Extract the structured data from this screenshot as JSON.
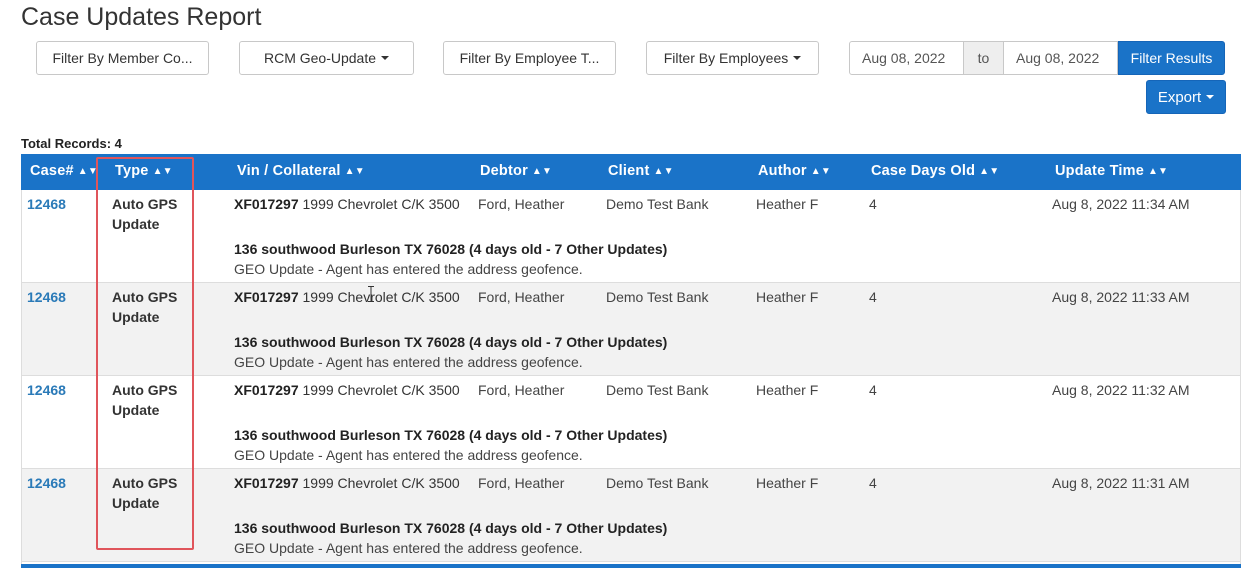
{
  "page": {
    "title": "Case Updates Report"
  },
  "filters": {
    "member_company": "Filter By Member Co...",
    "geo_update": "RCM Geo-Update",
    "employee_type": "Filter By Employee T...",
    "employees": "Filter By Employees",
    "date_from": "Aug 08, 2022",
    "date_to_label": "to",
    "date_to": "Aug 08, 2022",
    "filter_results": "Filter Results",
    "export": "Export"
  },
  "summary": {
    "total_records": "Total Records: 4"
  },
  "table": {
    "headers": [
      "Case#",
      "Type",
      "Vin / Collateral",
      "Debtor",
      "Client",
      "Author",
      "Case Days Old",
      "Update Time"
    ],
    "rows": [
      {
        "case": "12468",
        "type_line1": "Auto GPS",
        "type_line2": "Update",
        "vin": "XF017297",
        "collateral": "1999 Chevrolet C/K 3500",
        "debtor": "Ford, Heather",
        "client": "Demo Test Bank",
        "author": "Heather F",
        "days_old": "4",
        "update_time": "Aug 8, 2022 11:34 AM",
        "address": "136 southwood Burleson TX 76028 (4 days old - 7 Other Updates)",
        "note": "GEO Update - Agent has entered the address geofence."
      },
      {
        "case": "12468",
        "type_line1": "Auto GPS",
        "type_line2": "Update",
        "vin": "XF017297",
        "collateral": "1999 Chevrolet C/K 3500",
        "debtor": "Ford, Heather",
        "client": "Demo Test Bank",
        "author": "Heather F",
        "days_old": "4",
        "update_time": "Aug 8, 2022 11:33 AM",
        "address": "136 southwood Burleson TX 76028 (4 days old - 7 Other Updates)",
        "note": "GEO Update - Agent has entered the address geofence."
      },
      {
        "case": "12468",
        "type_line1": "Auto GPS",
        "type_line2": "Update",
        "vin": "XF017297",
        "collateral": "1999 Chevrolet C/K 3500",
        "debtor": "Ford, Heather",
        "client": "Demo Test Bank",
        "author": "Heather F",
        "days_old": "4",
        "update_time": "Aug 8, 2022 11:32 AM",
        "address": "136 southwood Burleson TX 76028 (4 days old - 7 Other Updates)",
        "note": "GEO Update - Agent has entered the address geofence."
      },
      {
        "case": "12468",
        "type_line1": "Auto GPS",
        "type_line2": "Update",
        "vin": "XF017297",
        "collateral": "1999 Chevrolet C/K 3500",
        "debtor": "Ford, Heather",
        "client": "Demo Test Bank",
        "author": "Heather F",
        "days_old": "4",
        "update_time": "Aug 8, 2022 11:31 AM",
        "address": "136 southwood Burleson TX 76028 (4 days old - 7 Other Updates)",
        "note": "GEO Update - Agent has entered the address geofence."
      }
    ]
  },
  "colors": {
    "header_bg": "#1a73c8",
    "link": "#2a7ab8",
    "highlight": "#e0555b",
    "alt_row": "#f2f2f2"
  },
  "icons": {
    "sort": "sort-icon",
    "caret": "caret-down-icon",
    "cursor": "text-cursor-icon"
  }
}
